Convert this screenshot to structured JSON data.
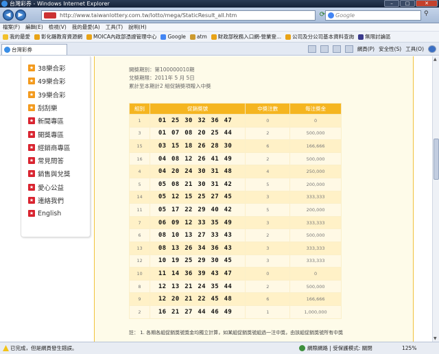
{
  "window": {
    "title": "台灣彩券 - Windows Internet Explorer"
  },
  "address": {
    "url": "http://www.taiwanlottery.com.tw/lotto/mega/StaticResult_all.htm",
    "search_placeholder": "Google"
  },
  "menu": [
    "檔案(F)",
    "編輯(E)",
    "檢視(V)",
    "我的最愛(A)",
    "工具(T)",
    "說明(H)"
  ],
  "favorites": [
    "我的最愛",
    "彰化縣教育資源網",
    "MOICA內政部憑證管理中心",
    "Google",
    "atm",
    "財政部稅務入口網-營業登...",
    "公司及分公司基本資料查詢",
    "無限討論區"
  ],
  "tab": {
    "label": "台灣彩券"
  },
  "commands": [
    "網頁(P)",
    "安全性(S)",
    "工具(O)"
  ],
  "sidebar": {
    "items": [
      {
        "label": "38樂合彩",
        "color": "orange"
      },
      {
        "label": "49樂合彩",
        "color": "orange"
      },
      {
        "label": "39樂合彩",
        "color": "orange"
      },
      {
        "label": "刮刮樂",
        "color": "orange"
      },
      {
        "label": "新聞專區",
        "color": "red"
      },
      {
        "label": "開獎專區",
        "color": "red"
      },
      {
        "label": "經銷商專區",
        "color": "red"
      },
      {
        "label": "常見問答",
        "color": "red"
      },
      {
        "label": "銷售與兌獎",
        "color": "red"
      },
      {
        "label": "愛心公益",
        "color": "red"
      },
      {
        "label": "連絡我們",
        "color": "red"
      },
      {
        "label": "English",
        "color": "red"
      }
    ]
  },
  "info": {
    "line1": "開獎期別：第100000010期",
    "line2": "兌獎期限：2011年 5 月 5日",
    "line3": "累計至本期計2 組促銷獎項贈入中獎"
  },
  "table": {
    "headers": [
      "組別",
      "促銷獎號",
      "中獎注數",
      "每注獎金"
    ],
    "rows": [
      [
        "1",
        "01 25 30 32 36 47",
        "0",
        "0"
      ],
      [
        "3",
        "01 07 08 20 25 44",
        "2",
        "500,000"
      ],
      [
        "15",
        "03 15 18 26 28 30",
        "6",
        "166,666"
      ],
      [
        "16",
        "04 08 12 26 41 49",
        "2",
        "500,000"
      ],
      [
        "4",
        "04 20 24 30 31 48",
        "4",
        "250,000"
      ],
      [
        "5",
        "05 08 21 30 31 42",
        "5",
        "200,000"
      ],
      [
        "14",
        "05 12 15 25 27 45",
        "3",
        "333,333"
      ],
      [
        "11",
        "05 17 22 29 40 42",
        "5",
        "200,000"
      ],
      [
        "7",
        "06 09 12 33 35 49",
        "3",
        "333,333"
      ],
      [
        "6",
        "08 10 13 27 33 43",
        "2",
        "500,000"
      ],
      [
        "13",
        "08 13 26 34 36 43",
        "3",
        "333,333"
      ],
      [
        "12",
        "10 19 25 29 30 45",
        "3",
        "333,333"
      ],
      [
        "10",
        "11 14 36 39 43 47",
        "0",
        "0"
      ],
      [
        "8",
        "12 13 21 24 35 44",
        "2",
        "500,000"
      ],
      [
        "9",
        "12 20 21 22 45 48",
        "6",
        "166,666"
      ],
      [
        "2",
        "16 21 27 44 46 49",
        "1",
        "1,000,000"
      ]
    ]
  },
  "note": "註： 1. 各期各組促銷獎號獎金均獨立計算，如某組促銷獎號組過一注中獎，由該組促銷獎號所有中獎",
  "status": {
    "left": "已完成，但是網頁發生錯誤。",
    "zone": "網際網路 | 受保護模式: 關閉",
    "zoom": "125%"
  }
}
